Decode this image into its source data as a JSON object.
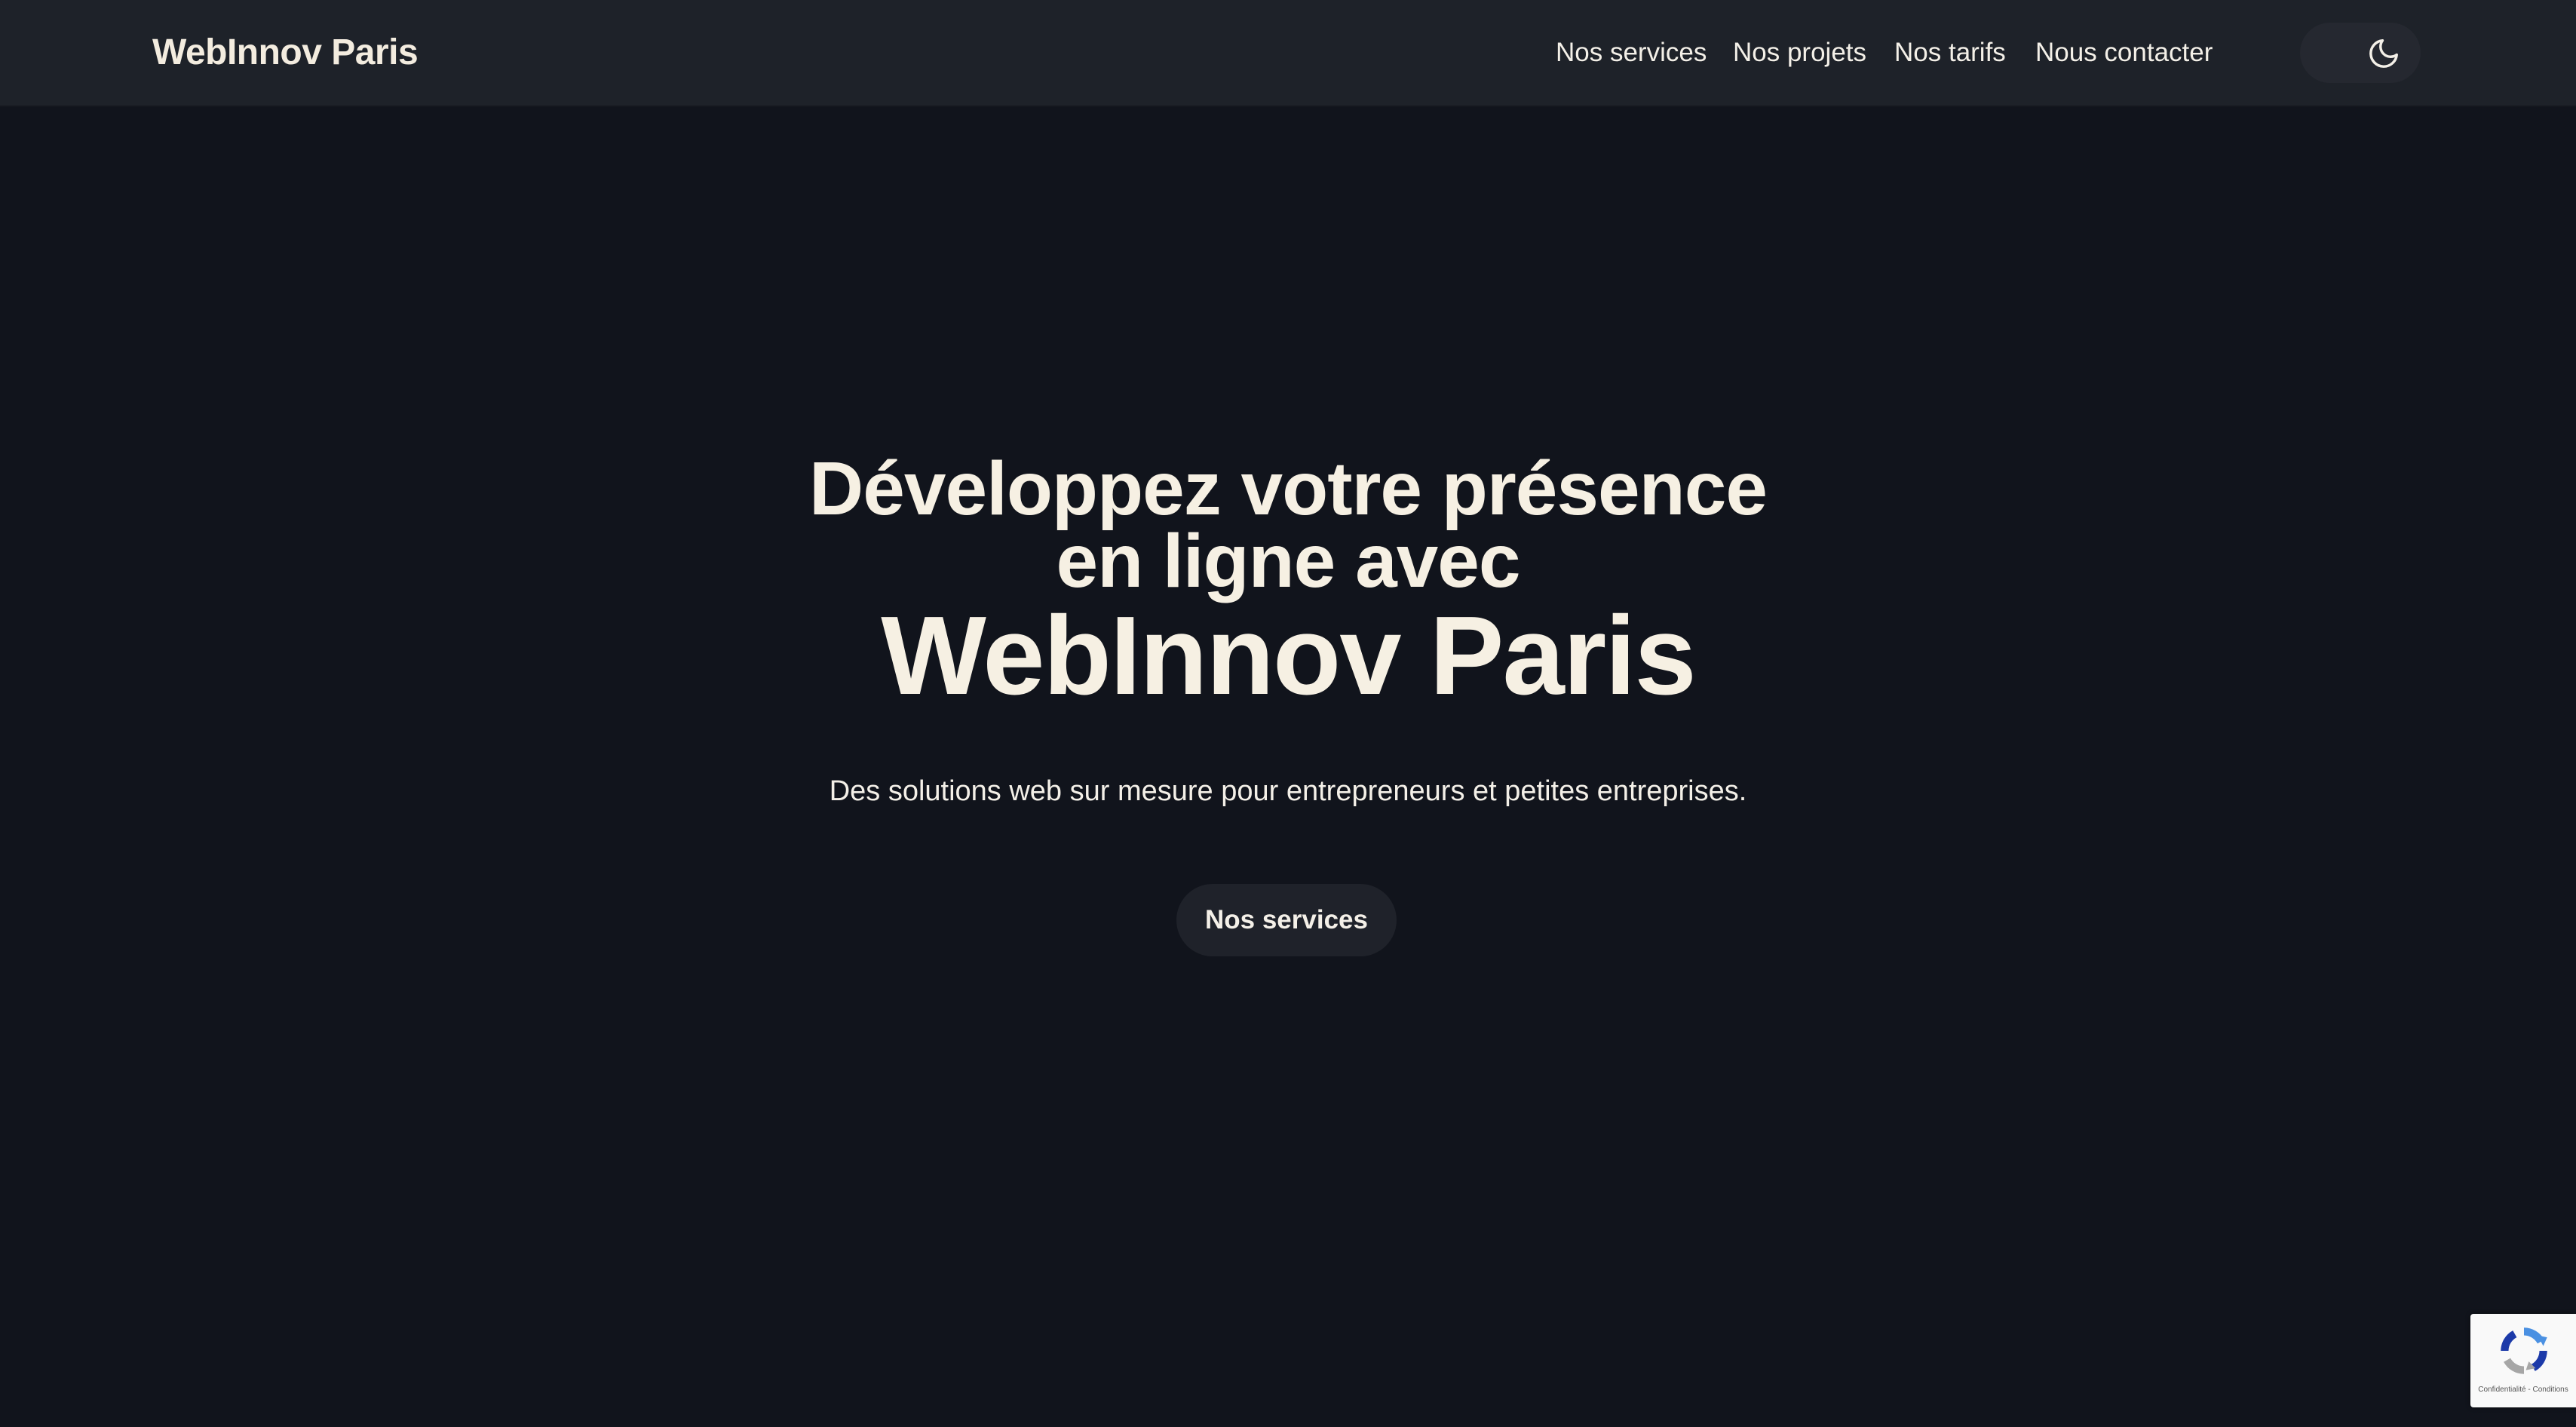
{
  "header": {
    "logo": "WebInnov Paris",
    "nav": [
      {
        "label": "Nos services"
      },
      {
        "label": "Nos projets"
      },
      {
        "label": "Nos tarifs"
      },
      {
        "label": "Nous contacter"
      }
    ],
    "theme_toggle_icon": "moon-icon"
  },
  "hero": {
    "line1": "Développez votre présence",
    "line2": "en ligne avec",
    "line3": "WebInnov Paris",
    "subtitle": "Des solutions web sur mesure pour entrepreneurs et petites entreprises.",
    "cta_label": "Nos services"
  },
  "recaptcha": {
    "icon": "recaptcha-icon",
    "terms": "Confidentialité - Conditions"
  },
  "colors": {
    "background": "#11141c",
    "header_background": "#1e2229",
    "text": "#f6f0e3",
    "button_background": "#1f222a"
  }
}
